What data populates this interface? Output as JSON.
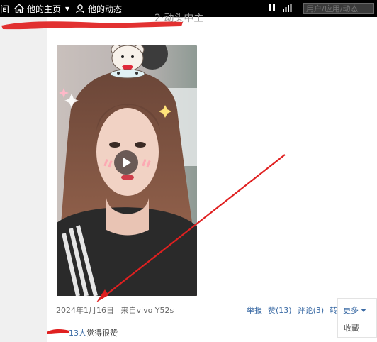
{
  "topbar": {
    "edge_char": "间",
    "home_label": "他的主页",
    "dynamics_label": "他的动态",
    "search_placeholder": "用户/应用/动态"
  },
  "post": {
    "title_fragment": "2·动头中主",
    "date": "2024年1月16日",
    "source": "来自vivo Y52s",
    "actions": {
      "report": "举报",
      "like": "赞(13)",
      "comment": "评论(3)",
      "forward": "转发"
    },
    "more_label": "更多",
    "favorite_label": "收藏",
    "likes_count": "13人",
    "likes_suffix": "觉得很赞"
  },
  "colors": {
    "topbar": "#000000",
    "link": "#3b6ba5",
    "redaction": "#e02020",
    "page_bg": "#f0f0f0"
  }
}
